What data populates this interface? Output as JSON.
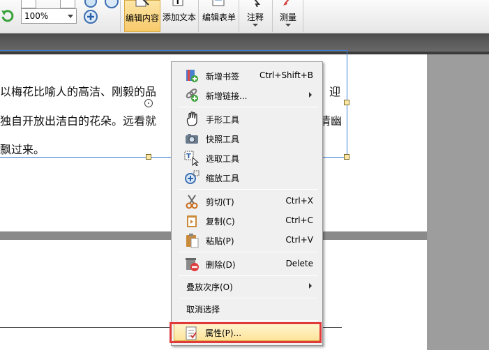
{
  "toolbar": {
    "zoom_value": "100%",
    "edit_content_label": "编辑内容",
    "add_text_label": "添加文本",
    "edit_form_label": "编辑表单",
    "annotate_label": "注释",
    "measure_label": "测量"
  },
  "document": {
    "line1_left": "以梅花比喻人的高洁、刚毅的品",
    "line1_right": "迎",
    "line2_left": "独自开放出洁白的花朵。远看就",
    "line2_right": "清幽",
    "line3_left": "飘过来。"
  },
  "context_menu": {
    "items": [
      {
        "label": "新增书签",
        "shortcut": "Ctrl+Shift+B",
        "icon": "bookmark-add-icon"
      },
      {
        "label": "新增链接...",
        "icon": "link-add-icon"
      },
      {
        "label": "手形工具",
        "icon": "hand-icon"
      },
      {
        "label": "快照工具",
        "icon": "camera-icon"
      },
      {
        "label": "选取工具",
        "icon": "text-select-icon"
      },
      {
        "label": "缩放工具",
        "icon": "zoom-icon"
      },
      {
        "label": "剪切(T)",
        "shortcut": "Ctrl+X",
        "icon": "scissors-icon"
      },
      {
        "label": "复制(C)",
        "shortcut": "Ctrl+C",
        "icon": "copy-icon"
      },
      {
        "label": "粘贴(P)",
        "shortcut": "Ctrl+V",
        "icon": "paste-icon"
      },
      {
        "label": "删除(D)",
        "shortcut": "Delete",
        "icon": "delete-icon"
      },
      {
        "label": "叠放次序(O)"
      },
      {
        "label": "取消选择"
      },
      {
        "label": "属性(P)...",
        "icon": "properties-icon"
      }
    ]
  },
  "colors": {
    "highlight_border": "#e03a3a",
    "selection_border": "#3b7ed8",
    "active_button": "#f7c96a"
  }
}
